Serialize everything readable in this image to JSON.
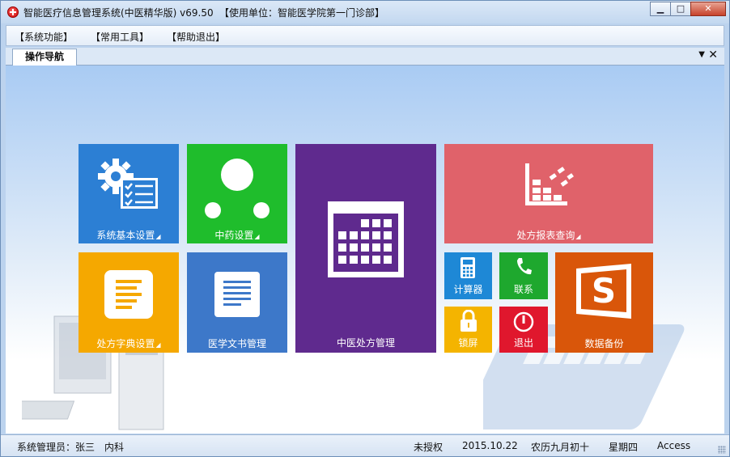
{
  "window": {
    "title": "智能医疗信息管理系统(中医精华版) v69.50",
    "unit": "【使用单位：智能医学院第一门诊部】",
    "controls": {
      "minimize": "▁",
      "maximize": "□",
      "close": "✕"
    }
  },
  "menu": {
    "items": [
      "【系统功能】",
      "【常用工具】",
      "【帮助退出】"
    ]
  },
  "tabs": {
    "active": "操作导航",
    "dropdown": "▼",
    "close": "✕"
  },
  "tiles": {
    "system_settings": {
      "label": "系统基本设置",
      "arrow": "◢",
      "color": "#2c7fd4"
    },
    "herb_settings": {
      "label": "中药设置",
      "arrow": "◢",
      "color": "#1fbd2c"
    },
    "tcm_prescription": {
      "label": "中医处方管理",
      "color": "#5f2a8e"
    },
    "report_query": {
      "label": "处方报表查询",
      "arrow": "◢",
      "color": "#e0626a"
    },
    "dictionary": {
      "label": "处方字典设置",
      "arrow": "◢",
      "color": "#f5a800"
    },
    "documents": {
      "label": "医学文书管理",
      "color": "#3d78c9"
    },
    "calculator": {
      "label": "计算器",
      "color": "#1e88d6"
    },
    "contact": {
      "label": "联系",
      "color": "#1ea82e"
    },
    "lock": {
      "label": "锁屏",
      "color": "#f4b400"
    },
    "exit": {
      "label": "退出",
      "color": "#e0172d"
    },
    "backup": {
      "label": "数据备份",
      "color": "#d9560a"
    }
  },
  "status": {
    "user": "系统管理员：张三",
    "dept": "内科",
    "license": "未授权",
    "date": "2015.10.22",
    "lunar": "农历九月初十",
    "weekday": "星期四",
    "db": "Access"
  }
}
